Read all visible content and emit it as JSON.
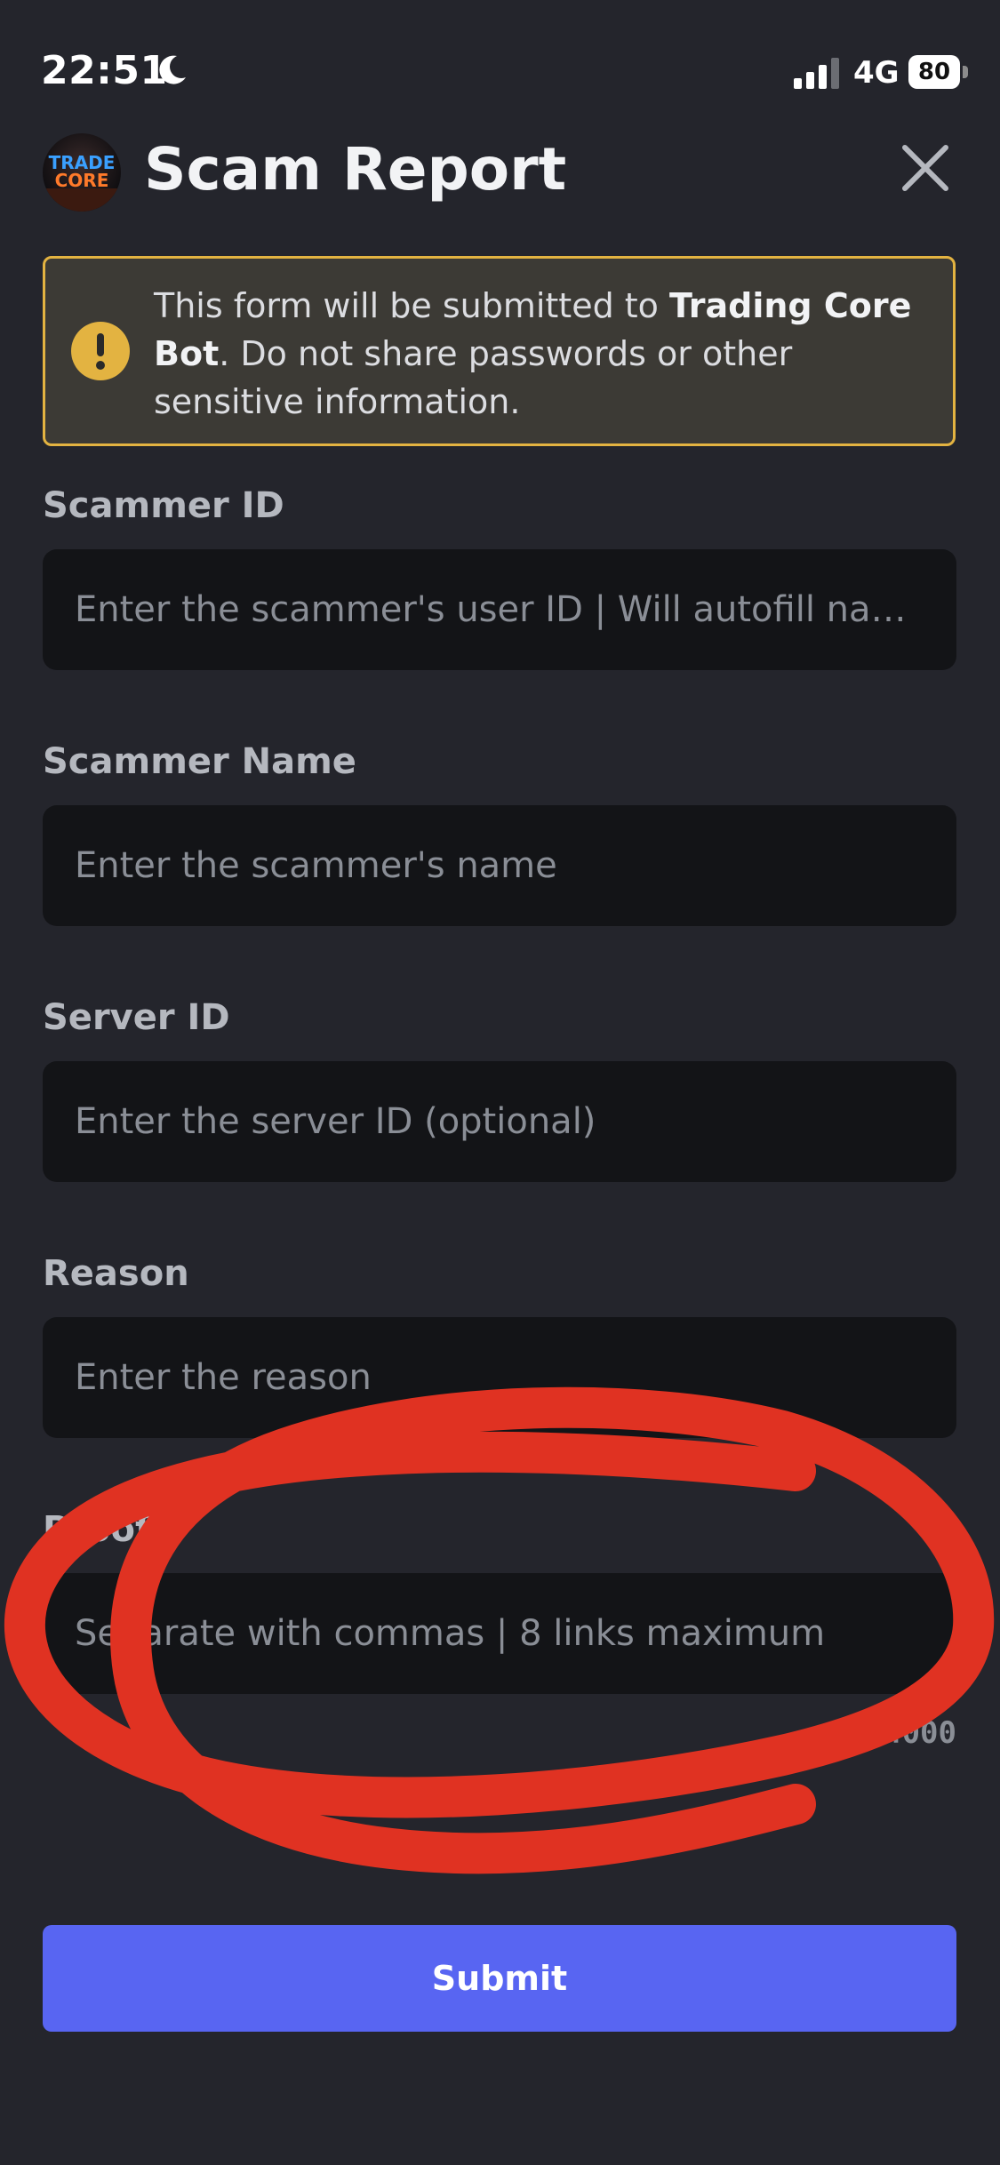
{
  "status_bar": {
    "time": "22:51",
    "network": "4G",
    "battery": "80",
    "icons": [
      "moon-icon",
      "signal-icon",
      "battery-icon"
    ]
  },
  "header": {
    "title": "Scam Report",
    "avatar_text_top": "TRADE",
    "avatar_text_bottom": "CORE",
    "close_icon": "close-icon"
  },
  "notice": {
    "text_before": "This form will be submitted to ",
    "bot_name": "Trading Core Bot",
    "text_after": ". Do not share passwords or other sensitive information.",
    "icon": "warning-icon"
  },
  "fields": [
    {
      "label": "Scammer ID",
      "placeholder": "Enter the scammer's user ID | Will autofill name",
      "value": ""
    },
    {
      "label": "Scammer Name",
      "placeholder": "Enter the scammer's name",
      "value": ""
    },
    {
      "label": "Server ID",
      "placeholder": "Enter the server ID (optional)",
      "value": ""
    },
    {
      "label": "Reason",
      "placeholder": "Enter the reason",
      "value": ""
    },
    {
      "label": "Proof",
      "placeholder": "Separate with commas | 8 links maximum",
      "value": ""
    }
  ],
  "proof_counter": "4000",
  "submit_label": "Submit",
  "colors": {
    "background": "#24252c",
    "input_background": "#131417",
    "warning_border": "#e3b341",
    "submit": "#5865f2",
    "annotation": "#e03222"
  }
}
